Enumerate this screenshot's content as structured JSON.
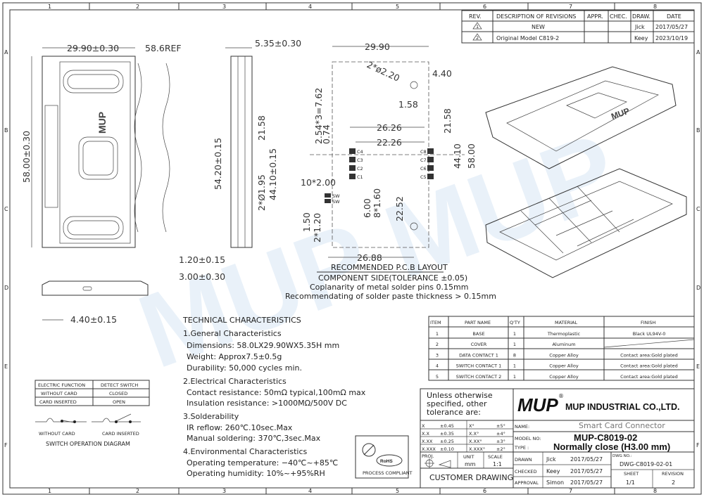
{
  "frame": {
    "columns": [
      "1",
      "2",
      "3",
      "4",
      "5",
      "6",
      "7",
      "8"
    ],
    "rows": [
      "A",
      "B",
      "C",
      "D",
      "E",
      "F"
    ]
  },
  "revisions": {
    "headers": [
      "REV.",
      "DESCRIPTION OF REVISIONS",
      "APPR.",
      "CHEC.",
      "DRAW.",
      "DATE"
    ],
    "rows": [
      {
        "rev": "1",
        "description": "NEW",
        "appr": "",
        "chec": "",
        "draw": "Jick",
        "date": "2017/05/27"
      },
      {
        "rev": "2",
        "description": "Original Model C819-2",
        "appr": "",
        "chec": "",
        "draw": "Keey",
        "date": "2023/10/19"
      }
    ]
  },
  "front_view": {
    "width_dim": "29.90±0.30",
    "ref_dim": "58.6REF",
    "height_dim": "58.00±0.30",
    "logo": "MUP"
  },
  "side_view": {
    "thickness": "5.35±0.30",
    "length": "54.20±0.15",
    "pitch": "44.10±0.15",
    "offset": "21.58",
    "holes": "2*Ø1.95",
    "d1": "1.20±0.15",
    "d2": "3.00±0.30"
  },
  "bottom_view": {
    "dim": "4.40±0.15"
  },
  "pcb_layout": {
    "dims": [
      "29.90",
      "2*ø2.20",
      "4.40",
      "1.58",
      "26.26",
      "22.26",
      "21.58",
      "44.10",
      "58.00",
      "2.54*3=7.62",
      "0.74",
      "10*2.00",
      "8*1.60",
      "6.00",
      "22.52",
      "1.50",
      "2*1.20",
      "26.88"
    ],
    "contacts_left": [
      "C4",
      "C3",
      "C2",
      "C1"
    ],
    "contacts_right": [
      "C8",
      "C7",
      "C6",
      "C5"
    ],
    "switch": [
      "SW",
      "SW"
    ],
    "title": "RECOMMENDED P.C.B LAYOUT",
    "subtitle": "COMPONENT SIDE(TOLERANCE ±0.05)",
    "note1": "Coplanarity of metal solder pins 0.15mm",
    "note2": "Recommendating of  solder paste thickness > 0.15mm"
  },
  "technical": {
    "title": "TECHNICAL CHARACTERISTICS",
    "sections": [
      {
        "heading": "1.General Characteristics",
        "lines": [
          "Dimensions: 58.0LX29.90WX5.35H  mm",
          "Weight: Approx7.5±0.5g",
          "Durability: 50,000  cycles  min."
        ]
      },
      {
        "heading": "2.Electrical Characteristics",
        "lines": [
          "Contact  resistance: 50mΩ  typical,100mΩ  max",
          "Insulation  resistance: >1000MΩ/500V  DC"
        ]
      },
      {
        "heading": "3.Solderability",
        "lines": [
          "IR  reflow: 260℃.10sec.Max",
          "Manual  soldering: 370℃,3sec.Max"
        ]
      },
      {
        "heading": "4.Environmental Characteristics",
        "lines": [
          "Operating  temperature: −40℃~+85℃",
          "Operating  humidity: 10%~+95%RH"
        ]
      }
    ]
  },
  "switch_table": {
    "headers": [
      "ELECTRIC FUNCTION",
      "DETECT SWITCH"
    ],
    "rows": [
      [
        "WITHOUT CARD",
        "CLOSED"
      ],
      [
        "CARD INSERTED",
        "OPEN"
      ]
    ],
    "diagram_labels": [
      "WITHOUT CARD",
      "CARD INSERTED"
    ],
    "diagram_title": "SWITCH OPERATION DIAGRAM"
  },
  "rohs": {
    "badge": "RoHS",
    "caption": "PROCESS COMPLIANT"
  },
  "parts": {
    "headers": [
      "ITEM",
      "PART NAME",
      "Q'TY",
      "MATERIAL",
      "FINISH"
    ],
    "rows": [
      [
        "1",
        "BASE",
        "1",
        "Thermoplastic",
        "Black UL94V-0"
      ],
      [
        "2",
        "COVER",
        "1",
        "Aluminum",
        ""
      ],
      [
        "3",
        "DATA CONTACT 1",
        "8",
        "Copper Alloy",
        "Contact area:Gold plated"
      ],
      [
        "4",
        "SWITCH CONTACT 1",
        "1",
        "Copper Alloy",
        "Contact area:Gold plated"
      ],
      [
        "5",
        "SWITCH CONTACT 2",
        "1",
        "Copper Alloy",
        "Contact area:Gold plated"
      ]
    ]
  },
  "title_block": {
    "tolerance_note": [
      "Unless otherwise",
      "specified, other",
      "tolerance are:"
    ],
    "tolerances": [
      [
        "X",
        "±0.45",
        "X°",
        "±5°"
      ],
      [
        "X.X",
        "±0.35",
        "X.X°",
        "±4°"
      ],
      [
        "X.XX",
        "±0.25",
        "X.XX°",
        "±3°"
      ],
      [
        "X.XXX",
        "±0.10",
        "X.XXX°",
        "±2°"
      ]
    ],
    "proj_label": "PROJ.",
    "unit_label": "UNIT",
    "unit": "mm",
    "scale_label": "SCALE",
    "scale": "1:1",
    "customer_drawing": "CUSTOMER  DRAWING",
    "logo": "MUP",
    "company": "MUP INDUSTRIAL CO.,LTD.",
    "name_label": "NAME:",
    "name": "Smart Card Connector",
    "model_label": "MODEL NO:",
    "model": "MUP-C8019-02",
    "type_label": "TYPE :",
    "type": "Normally close (H3.00 mm)",
    "approvals": [
      {
        "role": "DRAWN",
        "who": "Jick",
        "date": "2017/05/27"
      },
      {
        "role": "CHECKED",
        "who": "Keey",
        "date": "2017/05/27"
      },
      {
        "role": "APPROVAL",
        "who": "Simon",
        "date": "2017/05/27"
      }
    ],
    "dwg_label": "DWG NO.:",
    "dwg_no": "DWG-C8019-02-01",
    "sheet_label": "SHEET",
    "sheet": "1/1",
    "revision_label": "REVISION",
    "revision": "2"
  }
}
